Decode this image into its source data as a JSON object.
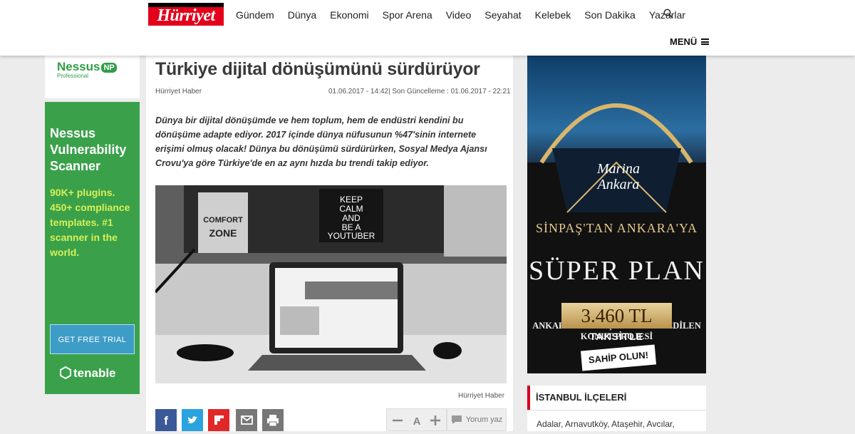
{
  "header": {
    "logo_text": "Hürriyet",
    "nav": [
      "Gündem",
      "Dünya",
      "Ekonomi",
      "Spor Arena",
      "Video",
      "Seyahat",
      "Kelebek",
      "Son Dakika",
      "Yazarlar"
    ],
    "menu_label": "MENÜ"
  },
  "left_ad": {
    "logo": "Nessus",
    "badge": "NP",
    "subtitle": "Professional",
    "title": "Nessus Vulnerability Scanner",
    "features": "90K+ plugins. 450+ compliance templates. #1 scanner in the world.",
    "cta": "GET FREE TRIAL",
    "brand": "tenable"
  },
  "article": {
    "headline": "Türkiye dijital dönüşümünü sürdürüyor",
    "author": "Hürriyet Haber",
    "published": "01.06.2017 - 14:42",
    "updated": "Son Güncelleme : 01.06.2017 - 22:21",
    "lede": "Dünya bir dijital dönüşümde ve hem toplum, hem de endüstri kendini bu dönüşüme adapte ediyor. 2017 içinde dünya nüfusunun %47'sinin internete erişimi olmuş olacak! Dünya bu dönüşümü sürdürürken, Sosyal Medya Ajansı Crovu'ya göre Türkiye'de en az aynı hızda bu trendi takip ediyor.",
    "image_caption": "Hürriyet Haber",
    "image_text": [
      "KEEP",
      "CALM",
      "AND",
      "BE A",
      "YOUTUBER"
    ],
    "poster_text": [
      "COMFORT",
      "ZONE"
    ]
  },
  "toolbar": {
    "font_label": "A",
    "comment_label": "Yorum yaz"
  },
  "right_ad": {
    "brand": "Marina Ankara",
    "line1": "SİNPAŞ'TAN ANKARA'YA",
    "headline": "SÜPER PLAN",
    "sub": "ANKARA'NIN EN ÇOK TERCİH EDİLEN KONUT PROJESİ",
    "price": "3.460 TL",
    "price_note": "TAKSİTLE",
    "cta": "SAHİP OLUN!"
  },
  "districts": {
    "title": "İSTANBUL İLÇELERİ",
    "list": "Adalar, Arnavutköy, Ataşehir, Avcılar,"
  },
  "colors": {
    "brand_red": "#e3001b",
    "nessus_green": "#3aa14a",
    "facebook": "#3b5998",
    "twitter": "#2aa3e0",
    "flipboard": "#e12828"
  }
}
